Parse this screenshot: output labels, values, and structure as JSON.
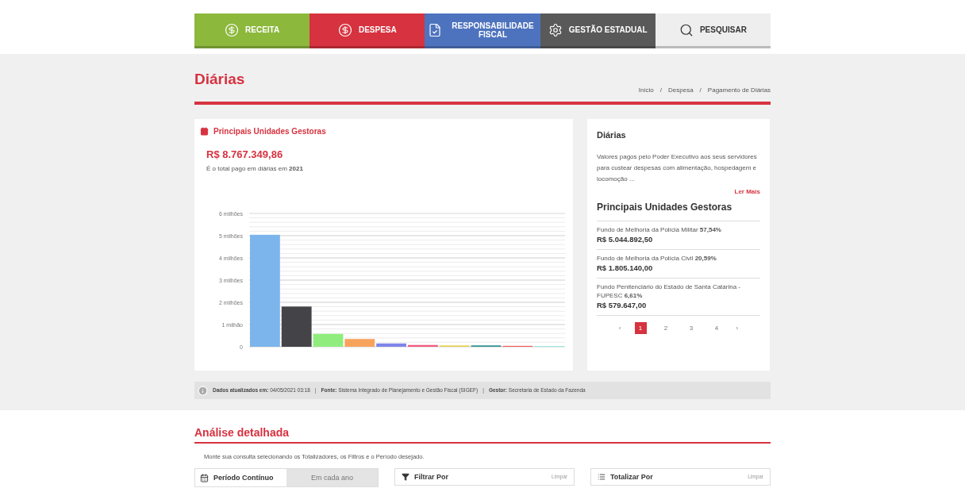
{
  "nav": [
    {
      "label": "RECEITA",
      "kind": "receita",
      "selected": false
    },
    {
      "label": "DESPESA",
      "kind": "despesa",
      "selected": false
    },
    {
      "label": "RESPONSABILIDADE FISCAL",
      "kind": "fiscal",
      "selected": false
    },
    {
      "label": "GESTÃO ESTADUAL",
      "kind": "gestao",
      "selected": false
    },
    {
      "label": "PESQUISAR",
      "kind": "search",
      "selected": false
    }
  ],
  "page": {
    "title": "Diárias",
    "breadcrumb": [
      "Início",
      "Despesa",
      "Pagamento de Diárias"
    ],
    "breadcrumb_separator": "/"
  },
  "main_card": {
    "title": "Principais Unidades Gestoras",
    "total": "R$ 8.767.349,86",
    "subtitle": "É o total pago em diárias em **2021**",
    "chart_data": {
      "type": "bar",
      "grid": true,
      "ylim": [
        0,
        6
      ],
      "yticks": [
        {
          "value": 0,
          "label": "0"
        },
        {
          "value": 1,
          "label": "1 milhão"
        },
        {
          "value": 2,
          "label": "2 milhões"
        },
        {
          "value": 3,
          "label": "3 milhões"
        },
        {
          "value": 4,
          "label": "4 milhões"
        },
        {
          "value": 5,
          "label": "5 milhões"
        },
        {
          "value": 6,
          "label": "6 milhões"
        }
      ],
      "series": [
        {
          "values": [
            5.04,
            1.81,
            0.58,
            0.35,
            0.15,
            0.08,
            0.06,
            0.06,
            0.04,
            0.03
          ]
        }
      ]
    },
    "bars": [
      {
        "color": "#7cb5ec"
      },
      {
        "color": "#434348"
      },
      {
        "color": "#90ed7d"
      },
      {
        "color": "#f7a35c"
      },
      {
        "color": "#8085e9"
      },
      {
        "color": "#f15c80"
      },
      {
        "color": "#e4d354"
      },
      {
        "color": "#2b908f"
      },
      {
        "color": "#f45b5b"
      },
      {
        "color": "#91e8e1"
      }
    ]
  },
  "side_card": {
    "title": "Diárias",
    "description": "Valores pagos pelo Poder Executivo aos seus servidores para custear despesas com alimentação, hospedagem e locomoção ...",
    "read_more": "Ler Mais",
    "list_title": "Principais Unidades Gestoras",
    "items": [
      {
        "name": "Fundo de Melhoria da Polícia Militar **57,54%**",
        "value": "R$ 5.044.892,50"
      },
      {
        "name": "Fundo de Melhoria da Polícia Civil **20,59%**",
        "value": "R$ 1.805.140,00"
      },
      {
        "name": "Fundo Penitenciário do Estado de Santa Catarina - FUPESC **6,61%**",
        "value": "R$ 579.647,00"
      }
    ],
    "pagination": {
      "prev": "‹",
      "next": "›",
      "pages": [
        {
          "label": "1",
          "selected": true
        },
        {
          "label": "2",
          "selected": false
        },
        {
          "label": "3",
          "selected": false
        },
        {
          "label": "4",
          "selected": false
        }
      ]
    }
  },
  "info_separator": "|",
  "info_bar": [
    "**Dados atualizados em:** 04/05/2021 03:18",
    "**Fonte:** Sistema Integrado de Planejamento e Gestão Fiscal (SIGEF)",
    "**Gestor:** Secretaria de Estado da Fazenda"
  ],
  "analysis": {
    "title": "Análise detalhada",
    "hint": "Monte sua consulta selecionando os Totalizadores, os Filtros e o Período desejado.",
    "period_tabs": [
      {
        "label": "Período Contínuo",
        "selected": true
      },
      {
        "label": "Em cada ano",
        "selected": false
      }
    ],
    "panels": [
      {
        "kind": "filter",
        "title": "Filtrar Por",
        "clear": "Limpar"
      },
      {
        "kind": "total",
        "title": "Totalizar Por",
        "clear": "Limpar"
      }
    ]
  }
}
